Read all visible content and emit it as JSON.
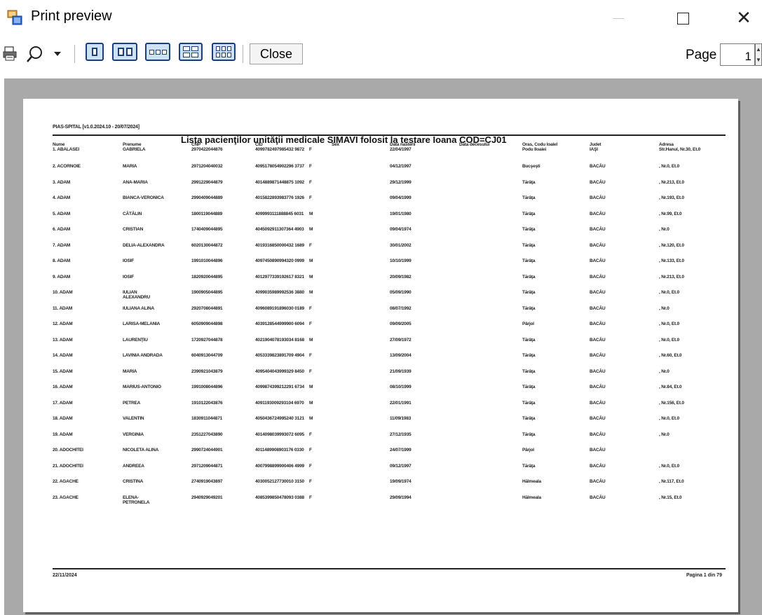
{
  "window": {
    "title": "Print preview"
  },
  "toolbar": {
    "close_label": "Close",
    "page_label": "Page",
    "page_value": "1",
    "buttons": [
      "print-icon",
      "zoom-icon",
      "one-page",
      "two-pages",
      "three-pages",
      "four-pages",
      "six-pages"
    ]
  },
  "report": {
    "header": "PIAS-SPITAL [v1.0.2024.10 - 20/07/2024]",
    "title": "Lista pacienţilor unităţii medicale SIMAVI folosit la testare Ioana COD=CJ01",
    "columns": [
      "Nume",
      "Prenume",
      "CNP",
      "CID",
      "Sex",
      "Data nasterii",
      "Data decesului",
      "Oras, Codu loalel",
      "Judet",
      "Adresa"
    ],
    "first_row": {
      "nume": "1. ABALASEI",
      "prenume": "GABRIELA",
      "cnp": "2970422044876",
      "cid": "4099782497985432 9872",
      "sex": "F",
      "data_nasterii": "22/04/1997",
      "oras": "Podu Iloaiei",
      "judet": "IAŞI",
      "adresa": "Str.Hanul, Nr.30, Et.0"
    },
    "rows": [
      {
        "nume": "2. ACORNOIE",
        "prenume": "MARIA",
        "cnp": "2971204040032",
        "cid": "4095178054902296 3737",
        "sex": "F",
        "data": "04/12/1997",
        "oras": "Bucşeşti",
        "judet": "BACĂU",
        "adresa": ", Nr.0, Et.0"
      },
      {
        "nume": "3. ADAM",
        "prenume": "ANA-MARIA",
        "cnp": "2991229044879",
        "cid": "4014889871448875 1092",
        "sex": "F",
        "data": "29/12/1999",
        "oras": "Tărâţa",
        "judet": "BACĂU",
        "adresa": ", Nr.213, Et.0"
      },
      {
        "nume": "4. ADAM",
        "prenume": "BIANCA-VERONICA",
        "cnp": "2990409044889",
        "cid": "4015822893983776 1926",
        "sex": "F",
        "data": "09/04/1999",
        "oras": "Tărâţa",
        "judet": "BACĂU",
        "adresa": ", Nr.193, Et.0"
      },
      {
        "nume": "5. ADAM",
        "prenume": "CĂTĂLIN",
        "cnp": "1800119044889",
        "cid": "4099993111888845 6031",
        "sex": "M",
        "data": "19/01/1980",
        "oras": "Tărâţa",
        "judet": "BACĂU",
        "adresa": ", Nr.99, Et.0"
      },
      {
        "nume": "6. ADAM",
        "prenume": "CRISTIAN",
        "cnp": "1740409044895",
        "cid": "4045092911307364 4903",
        "sex": "M",
        "data": "09/04/1974",
        "oras": "Tărâţa",
        "judet": "BACĂU",
        "adresa": ", Nr.0"
      },
      {
        "nume": "7. ADAM",
        "prenume": "DELIA-ALEXANDRA",
        "cnp": "6020130044872",
        "cid": "4019316850000432 1689",
        "sex": "F",
        "data": "30/01/2002",
        "oras": "Tărâţa",
        "judet": "BACĂU",
        "adresa": ", Nr.120, Et.0"
      },
      {
        "nume": "8. ADAM",
        "prenume": "IOSIF",
        "cnp": "1991010044896",
        "cid": "4097450890994320 0999",
        "sex": "M",
        "data": "10/10/1999",
        "oras": "Tărâţa",
        "judet": "BACĂU",
        "adresa": ", Nr.133, Et.0"
      },
      {
        "nume": "9. ADAM",
        "prenume": "IOSIF",
        "cnp": "1820920044895",
        "cid": "4012977339192617 8321",
        "sex": "M",
        "data": "20/09/1982",
        "oras": "Tărâţa",
        "judet": "BACĂU",
        "adresa": ", Nr.213, Et.0"
      },
      {
        "nume": "10. ADAM",
        "prenume": "IULIAN ALEXANDRU",
        "cnp": "1900905044895",
        "cid": "4099035989992536 3880",
        "sex": "M",
        "data": "05/09/1990",
        "oras": "Tărâţa",
        "judet": "BACĂU",
        "adresa": ", Nr.0, Et.0"
      },
      {
        "nume": "11. ADAM",
        "prenume": "IULIANA ALINA",
        "cnp": "2920708044891",
        "cid": "4096089191896030 0189",
        "sex": "F",
        "data": "08/07/1992",
        "oras": "Tărâţa",
        "judet": "BACĂU",
        "adresa": ", Nr.0"
      },
      {
        "nume": "12. ADAM",
        "prenume": "LARISA-MELANIA",
        "cnp": "6050909044898",
        "cid": "4039128544999900 6094",
        "sex": "F",
        "data": "09/09/2005",
        "oras": "Pârjol",
        "judet": "BACĂU",
        "adresa": ", Nr.0, Et.0"
      },
      {
        "nume": "13. ADAM",
        "prenume": "LAURENŢIU",
        "cnp": "1720927044878",
        "cid": "4021904078193034 8168",
        "sex": "M",
        "data": "27/09/1972",
        "oras": "Tărâţa",
        "judet": "BACĂU",
        "adresa": ", Nr.0, Et.0"
      },
      {
        "nume": "14. ADAM",
        "prenume": "LAVINIA ANDRADA",
        "cnp": "6040913044709",
        "cid": "4053339823891709 4904",
        "sex": "F",
        "data": "13/09/2004",
        "oras": "Tărâţa",
        "judet": "BACĂU",
        "adresa": ", Nr.60, Et.0"
      },
      {
        "nume": "15. ADAM",
        "prenume": "MARIA",
        "cnp": "2390921043879",
        "cid": "4095404043999329 8450",
        "sex": "F",
        "data": "21/09/1939",
        "oras": "Tărâţa",
        "judet": "BACĂU",
        "adresa": ", Nr.0"
      },
      {
        "nume": "16. ADAM",
        "prenume": "MARIUS-ANTONIO",
        "cnp": "1991008044896",
        "cid": "4099874399212291 6734",
        "sex": "M",
        "data": "08/10/1999",
        "oras": "Tărâţa",
        "judet": "BACĂU",
        "adresa": ", Nr.84, Et.0"
      },
      {
        "nume": "17. ADAM",
        "prenume": "PETREA",
        "cnp": "1910122043876",
        "cid": "4091193009293104 6970",
        "sex": "M",
        "data": "22/01/1991",
        "oras": "Tărâţa",
        "judet": "BACĂU",
        "adresa": ", Nr.156, Et.0"
      },
      {
        "nume": "18. ADAM",
        "prenume": "VALENTIN",
        "cnp": "1830911044871",
        "cid": "4050436724995240 3121",
        "sex": "M",
        "data": "11/09/1983",
        "oras": "Tărâţa",
        "judet": "BACĂU",
        "adresa": ", Nr.0, Et.0"
      },
      {
        "nume": "19. ADAM",
        "prenume": "VERGINIA",
        "cnp": "2351227043890",
        "cid": "4014098039993072 6095",
        "sex": "F",
        "data": "27/12/1935",
        "oras": "Tărâţa",
        "judet": "BACĂU",
        "adresa": ", Nr.0"
      },
      {
        "nume": "20. ADOCHITEI",
        "prenume": "NICOLETA ALINA",
        "cnp": "2990724044901",
        "cid": "4011489908903176 0330",
        "sex": "F",
        "data": "24/07/1999",
        "oras": "Pârjol",
        "judet": "BACĂU",
        "adresa": ""
      },
      {
        "nume": "21. ADOCHITEI",
        "prenume": "ANDREEA",
        "cnp": "2971209044871",
        "cid": "4007998899900406 4999",
        "sex": "F",
        "data": "09/12/1997",
        "oras": "Tărâţa",
        "judet": "BACĂU",
        "adresa": ", Nr.0, Et.0"
      },
      {
        "nume": "22. AGACHE",
        "prenume": "CRISTINA",
        "cnp": "2740919043897",
        "cid": "4030052127730010 3150",
        "sex": "F",
        "data": "19/09/1974",
        "oras": "Hălmeala",
        "judet": "BACĂU",
        "adresa": ", Nr.117, Et.0"
      },
      {
        "nume": "23. AGACHE",
        "prenume": "ELENA-PETRONELA",
        "cnp": "2940929049201",
        "cid": "4085399850478093 0388",
        "sex": "F",
        "data": "29/09/1994",
        "oras": "Hălmeala",
        "judet": "BACĂU",
        "adresa": ", Nr.15, Et.0"
      }
    ],
    "footer_date": "22/11/2024",
    "footer_page": "Pagina 1 din 79"
  }
}
